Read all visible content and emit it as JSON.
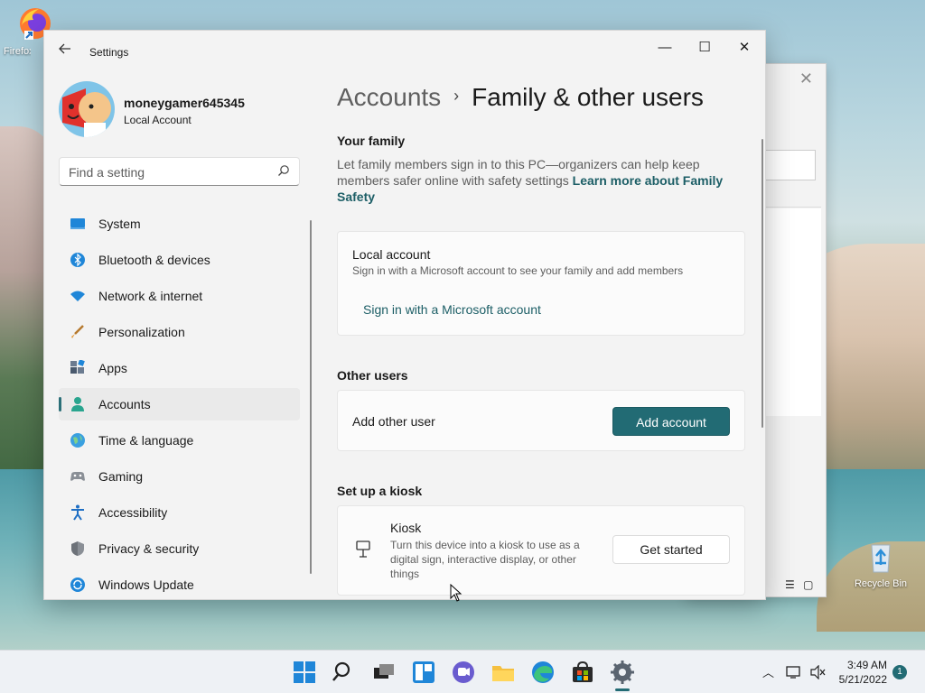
{
  "desktop": {
    "icons": [
      {
        "label": "Firefox"
      },
      {
        "label": "Recycle Bin"
      }
    ]
  },
  "window": {
    "title": "Settings",
    "controls": {
      "minimize": "—",
      "maximize": "☐",
      "close": "✕"
    }
  },
  "profile": {
    "name": "moneygamer645345",
    "account_type": "Local Account"
  },
  "search": {
    "placeholder": "Find a setting"
  },
  "sidebar": {
    "items": [
      {
        "label": "System",
        "icon": "system-icon",
        "color": "#1f7fd4"
      },
      {
        "label": "Bluetooth & devices",
        "icon": "bluetooth-icon",
        "color": "#1f7fd4"
      },
      {
        "label": "Network & internet",
        "icon": "wifi-icon",
        "color": "#1f7fd4"
      },
      {
        "label": "Personalization",
        "icon": "brush-icon",
        "color": "#c77a2e"
      },
      {
        "label": "Apps",
        "icon": "apps-icon",
        "color": "#4a5a6e"
      },
      {
        "label": "Accounts",
        "icon": "person-icon",
        "color": "#2aa58f",
        "active": true
      },
      {
        "label": "Time & language",
        "icon": "globe-icon",
        "color": "#1f7fd4"
      },
      {
        "label": "Gaming",
        "icon": "controller-icon",
        "color": "#8a8a8a"
      },
      {
        "label": "Accessibility",
        "icon": "accessibility-icon",
        "color": "#1f6fc4"
      },
      {
        "label": "Privacy & security",
        "icon": "shield-icon",
        "color": "#8a8f96"
      },
      {
        "label": "Windows Update",
        "icon": "update-icon",
        "color": "#1f7fd4"
      }
    ]
  },
  "breadcrumb": {
    "parent": "Accounts",
    "separator": "›",
    "current": "Family & other users"
  },
  "family": {
    "heading": "Your family",
    "description": "Let family members sign in to this PC—organizers can help keep members safer online with safety settings",
    "link": "Learn more about Family Safety",
    "card": {
      "title": "Local account",
      "subtitle": "Sign in with a Microsoft account to see your family and add members",
      "action": "Sign in with a Microsoft account"
    }
  },
  "other_users": {
    "heading": "Other users",
    "row_label": "Add other user",
    "button": "Add account"
  },
  "kiosk": {
    "heading": "Set up a kiosk",
    "title": "Kiosk",
    "description": "Turn this device into a kiosk to use as a digital sign, interactive display, or other things",
    "button": "Get started"
  },
  "taskbar": {
    "time": "3:49 AM",
    "date": "5/21/2022",
    "notification_count": "1"
  },
  "colors": {
    "accent": "#226b74",
    "link": "#1c5e66",
    "window_bg": "#f3f3f3",
    "card_bg": "#fbfbfb"
  }
}
